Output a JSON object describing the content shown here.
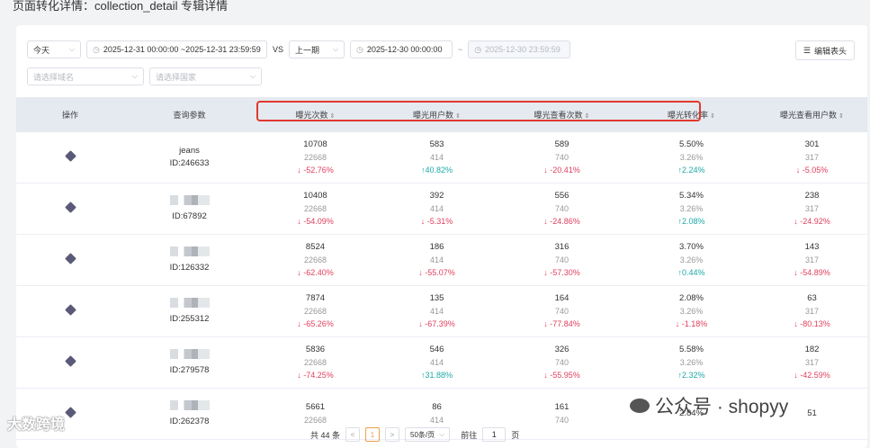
{
  "page_title": "页面转化详情：collection_detail 专辑详情",
  "filters": {
    "date_preset": "今天",
    "date_range": "2025-12-31 00:00:00 ~2025-12-31 23:59:59",
    "vs_label": "VS",
    "compare_preset": "上一期",
    "compare_start": "2025-12-30 00:00:00",
    "compare_sep": "~",
    "compare_end": "2025-12-30 23:59:59",
    "domain_placeholder": "请选择域名",
    "country_placeholder": "请选择国家",
    "edit_header": "编辑表头"
  },
  "table": {
    "headers": [
      "操作",
      "查询参数",
      "曝光次数",
      "曝光用户数",
      "曝光查看次数",
      "曝光转化率",
      "曝光查看用户数"
    ],
    "rows": [
      {
        "param": "jeans",
        "id": "ID:246633",
        "cols": [
          [
            "10708",
            "22668",
            "↓ -52.76%",
            "down"
          ],
          [
            "583",
            "414",
            "↑40.82%",
            "up"
          ],
          [
            "589",
            "740",
            "↓ -20.41%",
            "down"
          ],
          [
            "5.50%",
            "3.26%",
            "↑2.24%",
            "up"
          ],
          [
            "301",
            "317",
            "↓ -5.05%",
            "down"
          ]
        ]
      },
      {
        "param": "",
        "id": "ID:67892",
        "cols": [
          [
            "10408",
            "22668",
            "↓ -54.09%",
            "down"
          ],
          [
            "392",
            "414",
            "↓ -5.31%",
            "down"
          ],
          [
            "556",
            "740",
            "↓ -24.86%",
            "down"
          ],
          [
            "5.34%",
            "3.26%",
            "↑2.08%",
            "up"
          ],
          [
            "238",
            "317",
            "↓ -24.92%",
            "down"
          ]
        ]
      },
      {
        "param": "",
        "id": "ID:126332",
        "cols": [
          [
            "8524",
            "22668",
            "↓ -62.40%",
            "down"
          ],
          [
            "186",
            "414",
            "↓ -55.07%",
            "down"
          ],
          [
            "316",
            "740",
            "↓ -57.30%",
            "down"
          ],
          [
            "3.70%",
            "3.26%",
            "↑0.44%",
            "up"
          ],
          [
            "143",
            "317",
            "↓ -54.89%",
            "down"
          ]
        ]
      },
      {
        "param": "",
        "id": "ID:255312",
        "cols": [
          [
            "7874",
            "22668",
            "↓ -65.26%",
            "down"
          ],
          [
            "135",
            "414",
            "↓ -67.39%",
            "down"
          ],
          [
            "164",
            "740",
            "↓ -77.84%",
            "down"
          ],
          [
            "2.08%",
            "3.26%",
            "↓ -1.18%",
            "down"
          ],
          [
            "63",
            "317",
            "↓ -80.13%",
            "down"
          ]
        ]
      },
      {
        "param": "",
        "id": "ID:279578",
        "cols": [
          [
            "5836",
            "22668",
            "↓ -74.25%",
            "down"
          ],
          [
            "546",
            "414",
            "↑31.88%",
            "up"
          ],
          [
            "326",
            "740",
            "↓ -55.95%",
            "down"
          ],
          [
            "5.58%",
            "3.26%",
            "↑2.32%",
            "up"
          ],
          [
            "182",
            "317",
            "↓ -42.59%",
            "down"
          ]
        ]
      },
      {
        "param": "",
        "id": "ID:262378",
        "cols": [
          [
            "5661",
            "22668",
            "",
            " "
          ],
          [
            "86",
            "414",
            "",
            " "
          ],
          [
            "161",
            "740",
            "",
            " "
          ],
          [
            "2.84%",
            "",
            "",
            " "
          ],
          [
            "51",
            "",
            "",
            " "
          ]
        ]
      }
    ]
  },
  "pagination": {
    "total": "共 44 条",
    "prev": "<",
    "page": "1",
    "next": ">",
    "page_size": "50条/页",
    "goto_label": "前往",
    "goto_value": "1",
    "goto_suffix": "页"
  },
  "watermarks": {
    "left": "大数跨境",
    "right": "公众号 · shopyy"
  },
  "colors": {
    "down": "#e0405e",
    "up": "#1fa8a8",
    "highlight": "#e0392e",
    "active_page": "#e8a24a"
  }
}
